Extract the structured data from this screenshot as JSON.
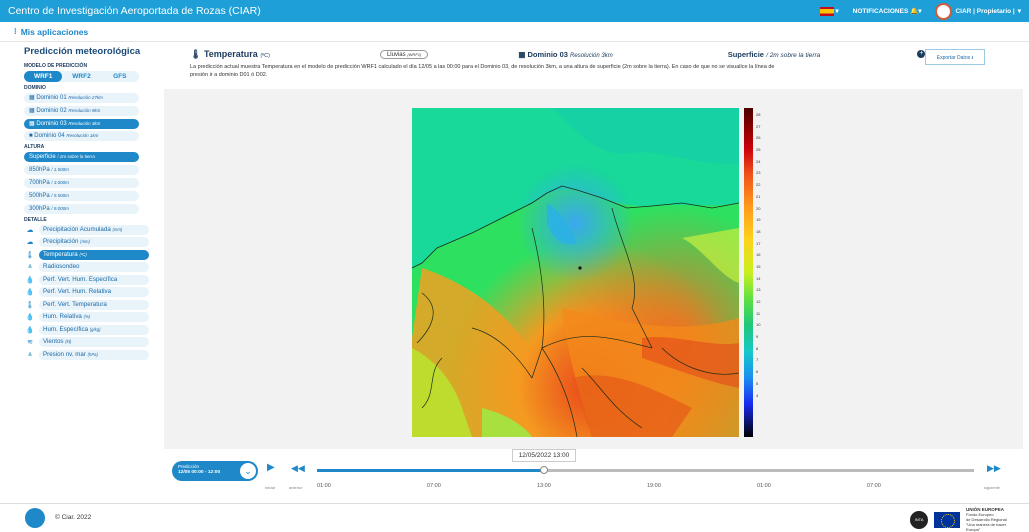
{
  "topbar": {
    "title": "Centro de Investigación Aeroportada de Rozas (CIAR)",
    "notifications": "NOTIFICACIONES",
    "user": "CIAR | Propietario |"
  },
  "subbar": {
    "apps": "Mis aplicaciones"
  },
  "sidebar": {
    "title": "Predicción meteorológica",
    "model_label": "MODELO DE PREDICCIÓN",
    "models": [
      "WRF1",
      "WRF2",
      "GFS"
    ],
    "domain_label": "DOMINIO",
    "domains": [
      {
        "name": "Dominio 01",
        "res": "Resolución 27km"
      },
      {
        "name": "Dominio 02",
        "res": "Resolución 9km"
      },
      {
        "name": "Dominio 03",
        "res": "Resolución 3km"
      },
      {
        "name": "Dominio 04",
        "res": "Resolución 1km"
      }
    ],
    "height_label": "ALTURA",
    "heights": [
      {
        "name": "Superficie",
        "sub": "/ 2m sobre la tierra"
      },
      {
        "name": "850hPa",
        "sub": "/ 1.500m"
      },
      {
        "name": "700hPa",
        "sub": "/ 3.000m"
      },
      {
        "name": "500hPa",
        "sub": "/ 5.500m"
      },
      {
        "name": "300hPa",
        "sub": "/ 9.000m"
      }
    ],
    "detail_label": "DETALLE",
    "details": [
      {
        "name": "Precipitación Acumulada",
        "unit": "(mm)"
      },
      {
        "name": "Precipitación",
        "unit": "(mm)"
      },
      {
        "name": "Temperatura",
        "unit": "(ºC)"
      },
      {
        "name": "Radiosondeo",
        "unit": ""
      },
      {
        "name": "Perf. Vert. Hum. Específica",
        "unit": ""
      },
      {
        "name": "Perf. Vert. Hum. Relativa",
        "unit": ""
      },
      {
        "name": "Perf. Vert. Temperatura",
        "unit": ""
      },
      {
        "name": "Hum. Relativa",
        "unit": "(%)"
      },
      {
        "name": "Hum. Específica",
        "unit": "(g/kg)"
      },
      {
        "name": "Vientos",
        "unit": "(kt)"
      },
      {
        "name": "Presion nv. mar",
        "unit": "(hPa)"
      }
    ]
  },
  "header": {
    "variable": "Temperatura",
    "variable_unit": "(ºC)",
    "rain_button": "Lluvias",
    "rain_sub": "(WRF1)",
    "domain": "Dominio 03",
    "domain_res": "Resolución 3km",
    "surface": "Superficie",
    "surface_sub": "/ 2m sobre la tierra",
    "export": "Exportar Datos",
    "description": "La predicción actual muestra Temperatura en el modelo de predicción WRF1 calculado el día 12/05 a las 00:00 para el Dominio 03, de resolución 3km, a una altura de superficie (2m sobre la tierra). En caso de que no se visualice la línea de presión ir a dominio D01 ó D02."
  },
  "colorbar_ticks": [
    "28",
    "27",
    "26",
    "25",
    "24",
    "23",
    "22",
    "21",
    "20",
    "19",
    "18",
    "17",
    "16",
    "15",
    "14",
    "13",
    "12",
    "11",
    "10",
    "9",
    "8",
    "7",
    "6",
    "5",
    "4"
  ],
  "timeline": {
    "pred_title": "Predicción",
    "pred_range": "12/05 00:00 - 12:00",
    "current": "12/05/2022 13:00",
    "iniciar": "iniciar",
    "anterior": "anterior",
    "siguiente": "siguiente",
    "labels": [
      "01:00",
      "07:00",
      "13:00",
      "19:00",
      "01:00",
      "07:00"
    ]
  },
  "footer": {
    "copyright": "© Ciar. 2022",
    "eu_title": "UNIÓN EUROPEA",
    "eu_line1": "Fondo Europeo",
    "eu_line2": "de Desarrollo Regional",
    "eu_line3": "\"Una manera de hacer Europa\""
  }
}
